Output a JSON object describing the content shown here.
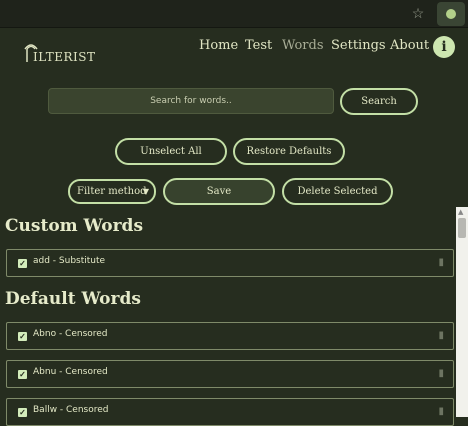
{
  "browser": {
    "extension_icon": "star-puzzle-icon",
    "profile_icon": "extension-leaf-icon"
  },
  "brand": {
    "logo_text": "ILTERIST"
  },
  "nav": {
    "home": "Home",
    "test": "Test",
    "words": "Words",
    "settings": "Settings",
    "about": "About"
  },
  "info_icon": "i",
  "search": {
    "placeholder": "Search for words..",
    "button": "Search"
  },
  "actions": {
    "unselect_all": "Unselect All",
    "restore_defaults": "Restore Defaults"
  },
  "toolbar": {
    "filter_method": "Filter method",
    "save": "Save",
    "delete_selected": "Delete Selected"
  },
  "sections": {
    "custom": "Custom Words",
    "default": "Default Words"
  },
  "custom_words": [
    {
      "label": "add - Substitute",
      "checked": true
    }
  ],
  "default_words": [
    {
      "label": "Abno - Censored",
      "checked": true
    },
    {
      "label": "Abnu - Censored",
      "checked": true
    },
    {
      "label": "Ballw - Censored",
      "checked": true
    }
  ],
  "colors": {
    "background": "#262d1f",
    "accent": "#c3dfa6",
    "text": "#e3e8c6"
  }
}
